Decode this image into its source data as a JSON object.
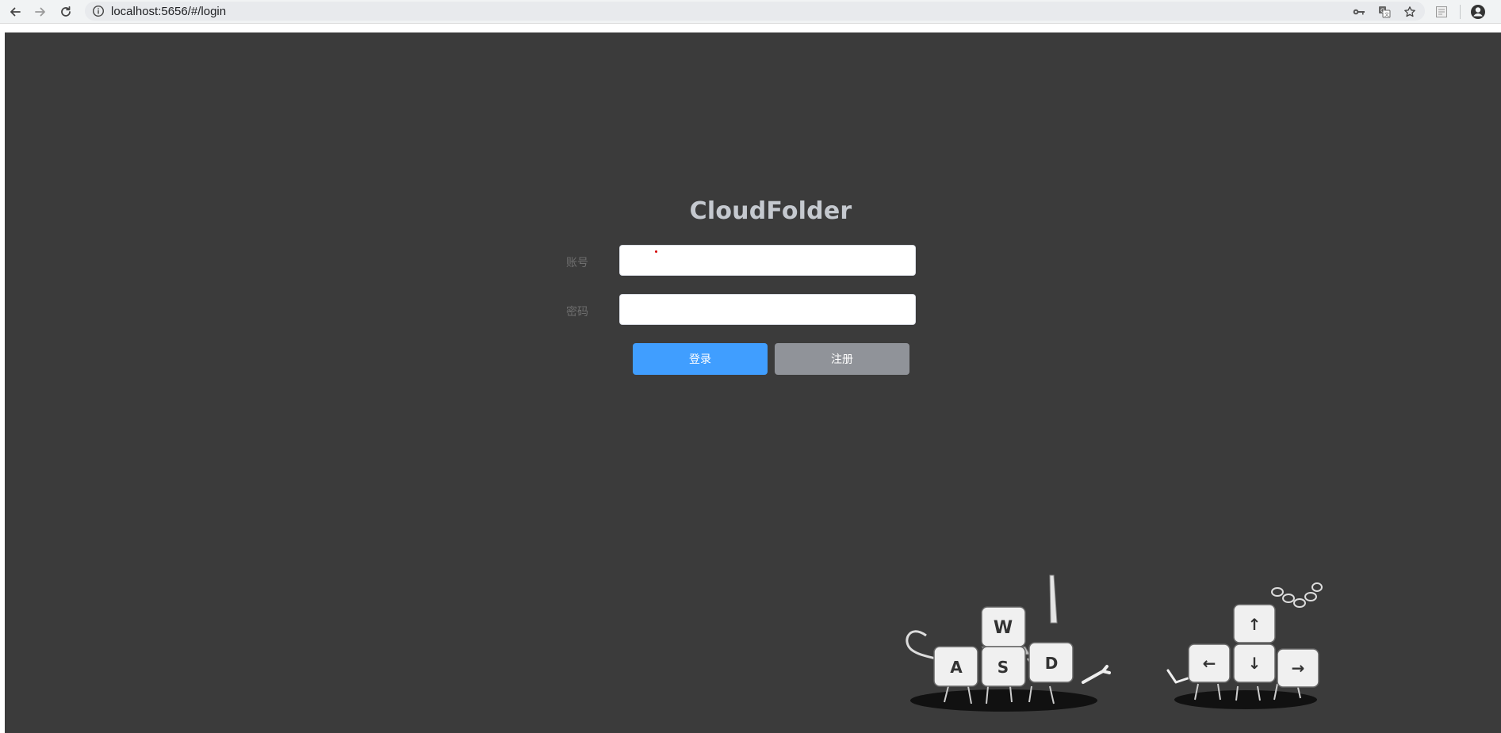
{
  "browser": {
    "url": "localhost:5656/#/login",
    "back_icon": "arrow-left-icon",
    "forward_icon": "arrow-right-icon",
    "reload_icon": "reload-icon",
    "info_icon": "info-icon",
    "key_icon": "key-icon",
    "translate_icon": "translate-icon",
    "star_icon": "star-icon",
    "extension_icon": "extension-icon",
    "profile_icon": "profile-icon"
  },
  "login": {
    "title": "CloudFolder",
    "account_label": "账号",
    "account_value": "",
    "password_label": "密码",
    "password_value": "",
    "login_button": "登录",
    "register_button": "注册"
  },
  "decor": {
    "keys_left": [
      "W",
      "A",
      "S",
      "D"
    ],
    "keys_right": [
      "↑",
      "←",
      "↓",
      "→"
    ]
  },
  "colors": {
    "background": "#3b3b3b",
    "title": "#c5c9cf",
    "login_button": "#409eff",
    "register_button": "#909399"
  }
}
